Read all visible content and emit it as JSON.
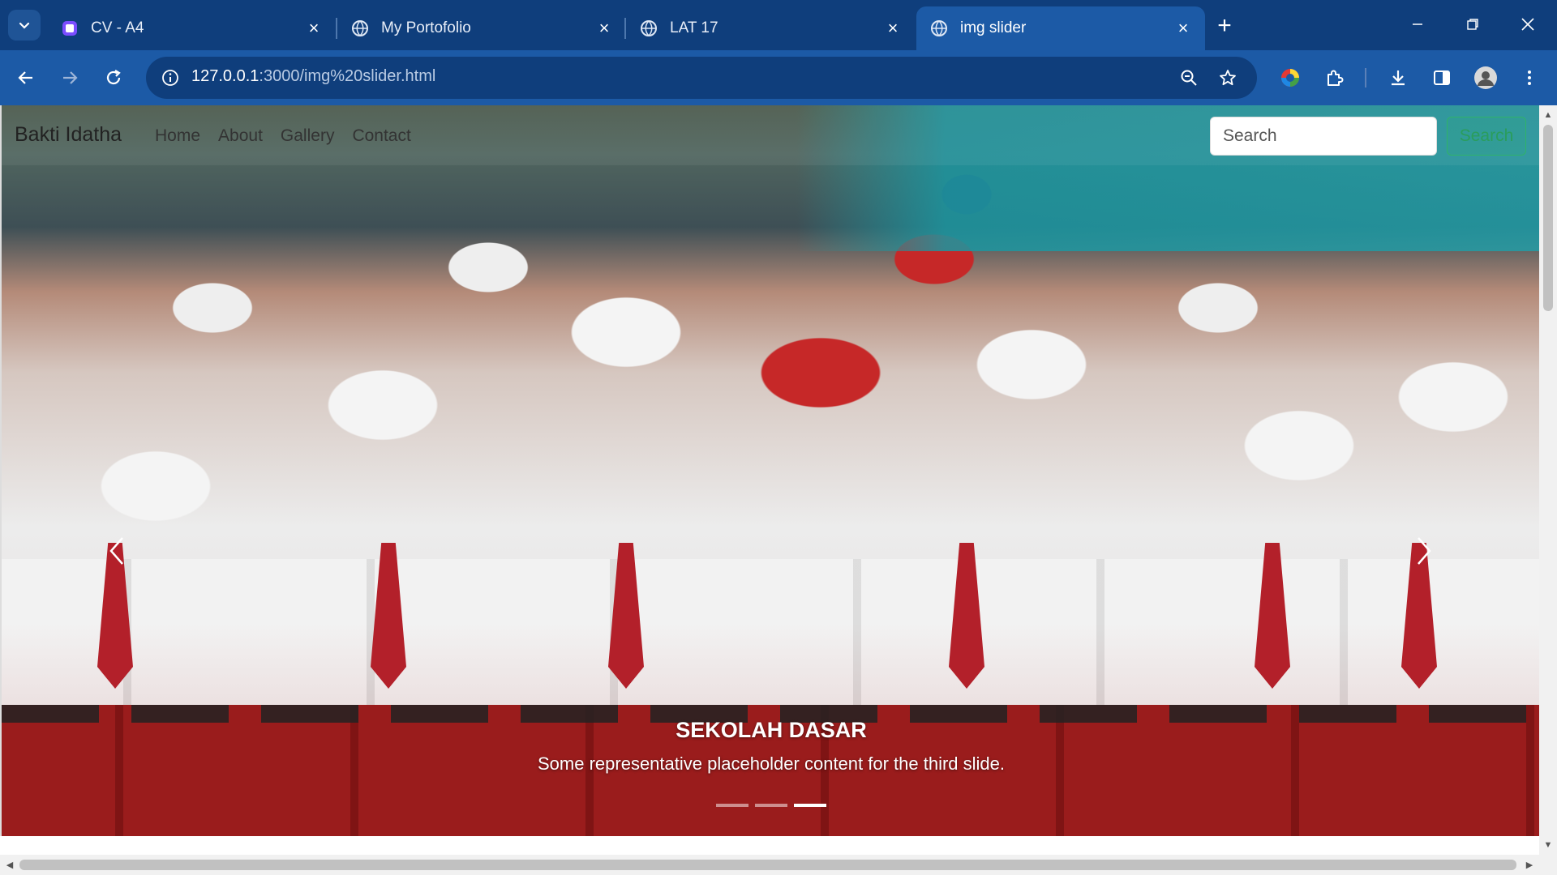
{
  "browser": {
    "tabs": [
      {
        "title": "CV - A4",
        "favicon": "canva-icon",
        "active": false
      },
      {
        "title": "My Portofolio",
        "favicon": "globe-icon",
        "active": false
      },
      {
        "title": "LAT 17",
        "favicon": "globe-icon",
        "active": false
      },
      {
        "title": "img slider",
        "favicon": "globe-icon",
        "active": true
      }
    ],
    "url_host": "127.0.0.1",
    "url_path": ":3000/img%20slider.html",
    "colors": {
      "tabbar": "#0f3e7c",
      "toolbar": "#1c5aa6"
    }
  },
  "page": {
    "brand": "Bakti Idatha",
    "nav": [
      "Home",
      "About",
      "Gallery",
      "Contact"
    ],
    "search_placeholder": "Search",
    "search_button": "Search",
    "carousel": {
      "caption_title": "SEKOLAH DASAR",
      "caption_text": "Some representative placeholder content for the third slide.",
      "slide_count": 3,
      "active_slide": 3
    }
  }
}
